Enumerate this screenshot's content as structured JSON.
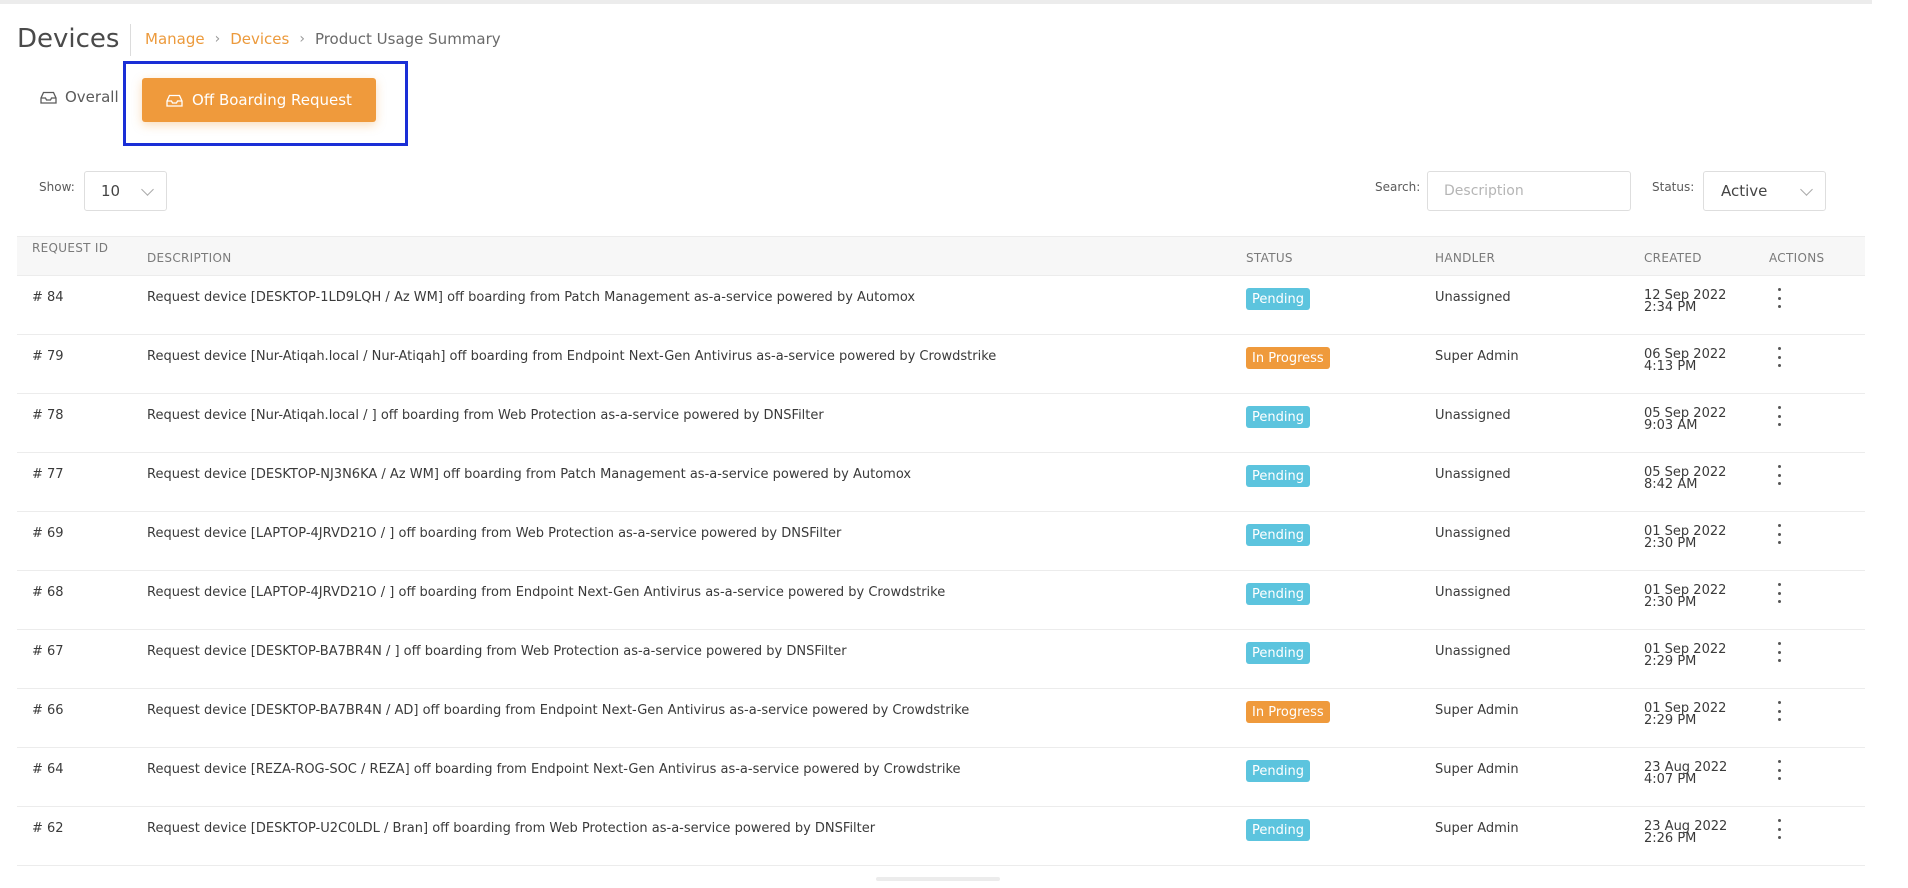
{
  "header": {
    "title": "Devices",
    "breadcrumb": [
      "Manage",
      "Devices",
      "Product Usage Summary"
    ]
  },
  "tabs": {
    "overall": "Overall",
    "active": "Off Boarding Request"
  },
  "controls": {
    "show_label": "Show:",
    "show_value": "10",
    "search_label": "Search:",
    "search_placeholder": "Description",
    "status_label": "Status:",
    "status_value": "Active"
  },
  "table": {
    "headers": {
      "request_id": "REQUEST ID",
      "description": "DESCRIPTION",
      "status": "STATUS",
      "handler": "HANDLER",
      "created": "CREATED",
      "actions": "ACTIONS"
    },
    "rows": [
      {
        "id": "# 84",
        "description": "Request device [DESKTOP-1LD9LQH / Az WM] off boarding from Patch Management as-a-service powered by Automox",
        "status": "Pending",
        "handler": "Unassigned",
        "created_date": "12 Sep 2022",
        "created_time": "2:34 PM"
      },
      {
        "id": "# 79",
        "description": "Request device [Nur-Atiqah.local / Nur-Atiqah] off boarding from Endpoint Next-Gen Antivirus as-a-service powered by Crowdstrike",
        "status": "In Progress",
        "handler": "Super Admin",
        "created_date": "06 Sep 2022",
        "created_time": "4:13 PM"
      },
      {
        "id": "# 78",
        "description": "Request device [Nur-Atiqah.local / ] off boarding from Web Protection as-a-service powered by DNSFilter",
        "status": "Pending",
        "handler": "Unassigned",
        "created_date": "05 Sep 2022",
        "created_time": "9:03 AM"
      },
      {
        "id": "# 77",
        "description": "Request device [DESKTOP-NJ3N6KA / Az WM] off boarding from Patch Management as-a-service powered by Automox",
        "status": "Pending",
        "handler": "Unassigned",
        "created_date": "05 Sep 2022",
        "created_time": "8:42 AM"
      },
      {
        "id": "# 69",
        "description": "Request device [LAPTOP-4JRVD21O / ] off boarding from Web Protection as-a-service powered by DNSFilter",
        "status": "Pending",
        "handler": "Unassigned",
        "created_date": "01 Sep 2022",
        "created_time": "2:30 PM"
      },
      {
        "id": "# 68",
        "description": "Request device [LAPTOP-4JRVD21O / ] off boarding from Endpoint Next-Gen Antivirus as-a-service powered by Crowdstrike",
        "status": "Pending",
        "handler": "Unassigned",
        "created_date": "01 Sep 2022",
        "created_time": "2:30 PM"
      },
      {
        "id": "# 67",
        "description": "Request device [DESKTOP-BA7BR4N / ] off boarding from Web Protection as-a-service powered by DNSFilter",
        "status": "Pending",
        "handler": "Unassigned",
        "created_date": "01 Sep 2022",
        "created_time": "2:29 PM"
      },
      {
        "id": "# 66",
        "description": "Request device [DESKTOP-BA7BR4N / AD] off boarding from Endpoint Next-Gen Antivirus as-a-service powered by Crowdstrike",
        "status": "In Progress",
        "handler": "Super Admin",
        "created_date": "01 Sep 2022",
        "created_time": "2:29 PM"
      },
      {
        "id": "# 64",
        "description": "Request device [REZA-ROG-SOC / REZA] off boarding from Endpoint Next-Gen Antivirus as-a-service powered by Crowdstrike",
        "status": "Pending",
        "handler": "Super Admin",
        "created_date": "23 Aug 2022",
        "created_time": "4:07 PM"
      },
      {
        "id": "# 62",
        "description": "Request device [DESKTOP-U2C0LDL / Bran] off boarding from Web Protection as-a-service powered by DNSFilter",
        "status": "Pending",
        "handler": "Super Admin",
        "created_date": "23 Aug 2022",
        "created_time": "2:26 PM"
      }
    ]
  },
  "colors": {
    "accent": "#ef9a3c",
    "pending": "#5cc4de",
    "in_progress": "#ef9a3c",
    "highlight": "#1a2fd6"
  }
}
